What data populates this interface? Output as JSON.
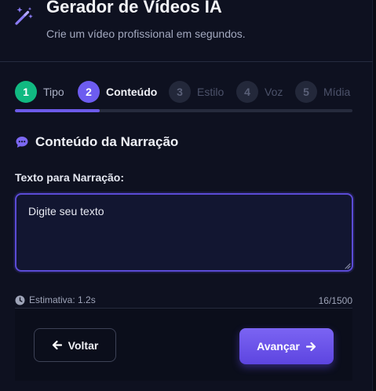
{
  "header": {
    "title": "Gerador de Vídeos IA",
    "subtitle": "Crie um vídeo profissional em segundos.",
    "logo_icon": "magic-wand-icon"
  },
  "steps": [
    {
      "number": "1",
      "label": "Tipo",
      "state": "done"
    },
    {
      "number": "2",
      "label": "Conteúdo",
      "state": "active"
    },
    {
      "number": "3",
      "label": "Estilo",
      "state": "todo"
    },
    {
      "number": "4",
      "label": "Voz",
      "state": "todo"
    },
    {
      "number": "5",
      "label": "Mídia",
      "state": "todo"
    }
  ],
  "progress": {
    "fraction": 0.25
  },
  "section": {
    "title": "Conteúdo da Narração",
    "icon": "chat-icon"
  },
  "narration": {
    "label": "Texto para Narração:",
    "value": "Digite seu texto",
    "estimate": "Estimativa: 1.2s",
    "counter": "16/1500"
  },
  "footer": {
    "back_label": "Voltar",
    "next_label": "Avançar"
  },
  "colors": {
    "accent": "#6d5cf0",
    "success": "#11b981",
    "background": "#0e1120",
    "field_background": "#121631"
  }
}
